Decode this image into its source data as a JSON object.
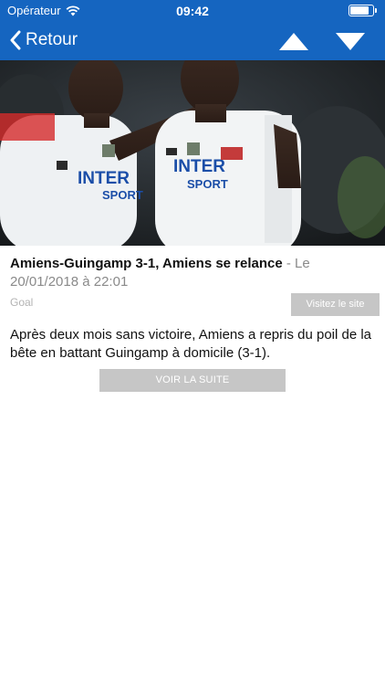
{
  "status_bar": {
    "carrier": "Opérateur",
    "time": "09:42",
    "battery_level": 0.9
  },
  "nav": {
    "back_label": "Retour",
    "back_icon": "chevron-left-icon",
    "prev_icon": "triangle-up-icon",
    "next_icon": "triangle-down-icon"
  },
  "article": {
    "image_alt": "Deux joueurs d'Amiens célébrant",
    "title": "Amiens-Guingamp 3-1, Amiens se relance",
    "date": " - Le 20/01/2018 à 22:01",
    "source": "Goal",
    "visit_label": "Visitez le site",
    "summary": "Après deux mois sans victoire, Amiens a repris du poil de la bête en battant Guingamp à domicile (3-1).",
    "more_label": "VOIR LA SUITE"
  },
  "colors": {
    "nav_bar": "#1565c0",
    "button_gray": "#c6c6c6"
  }
}
